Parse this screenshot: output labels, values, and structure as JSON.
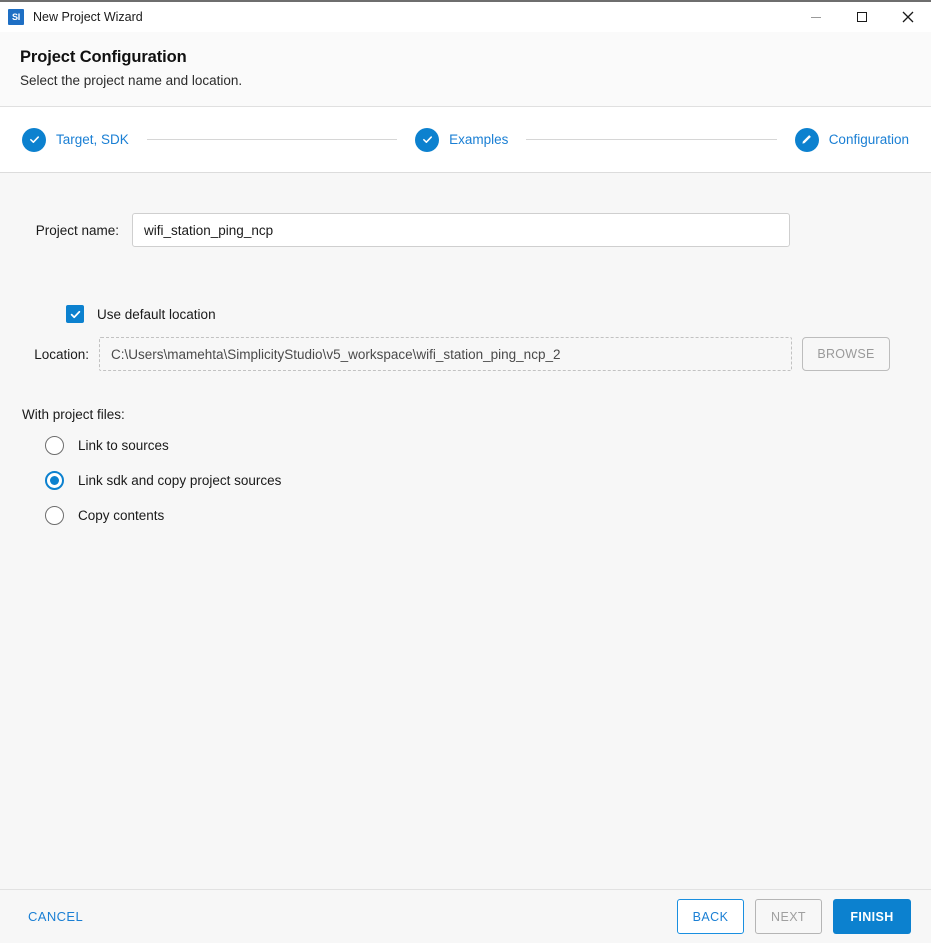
{
  "window": {
    "title": "New Project Wizard",
    "app_icon": "simplicity-studio-icon",
    "app_icon_text": "SI",
    "controls": {
      "minimize": "minimize-icon",
      "maximize": "maximize-icon",
      "close": "close-icon"
    }
  },
  "header": {
    "title": "Project Configuration",
    "subtitle": "Select the project name and location."
  },
  "stepper": {
    "steps": [
      {
        "label": "Target, SDK",
        "icon": "check-icon",
        "state": "complete"
      },
      {
        "label": "Examples",
        "icon": "check-icon",
        "state": "complete"
      },
      {
        "label": "Configuration",
        "icon": "pencil-icon",
        "state": "current"
      }
    ]
  },
  "form": {
    "project_name": {
      "label": "Project name:",
      "value": "wifi_station_ping_ncp",
      "placeholder": "Project name"
    },
    "use_default_location": {
      "label": "Use default location",
      "checked": true
    },
    "location": {
      "label": "Location:",
      "value": "C:\\Users\\mamehta\\SimplicityStudio\\v5_workspace\\wifi_station_ping_ncp_2",
      "placeholder": "Location",
      "disabled": true
    },
    "browse_button": {
      "label": "BROWSE",
      "disabled": true
    },
    "project_files": {
      "title": "With project files:",
      "options": [
        {
          "label": "Link to sources",
          "selected": false
        },
        {
          "label": "Link sdk and copy project sources",
          "selected": true
        },
        {
          "label": "Copy contents",
          "selected": false
        }
      ]
    }
  },
  "footer": {
    "cancel": "CANCEL",
    "back": "BACK",
    "next": "NEXT",
    "finish": "FINISH"
  },
  "colors": {
    "accent_blue": "#0c81cf",
    "link_blue": "#1a7fd4",
    "body_bg": "#f7f7f7",
    "disabled_gray": "#a0a0a0"
  }
}
